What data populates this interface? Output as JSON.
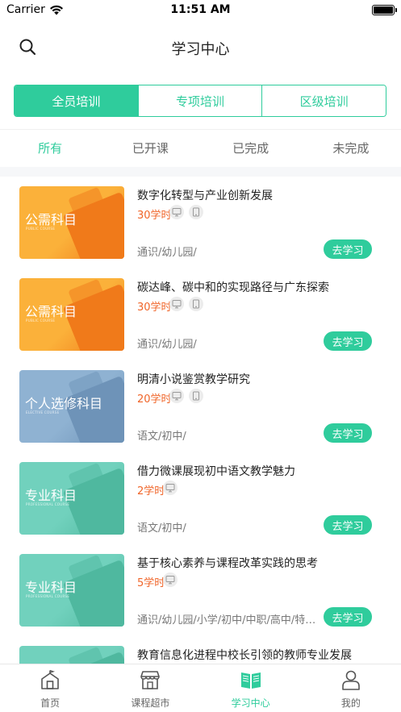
{
  "status": {
    "carrier": "Carrier",
    "time": "11:51 AM"
  },
  "nav": {
    "title": "学习中心"
  },
  "segments": [
    {
      "label": "全员培训",
      "active": true
    },
    {
      "label": "专项培训",
      "active": false
    },
    {
      "label": "区级培训",
      "active": false
    }
  ],
  "filters": [
    {
      "label": "所有",
      "active": true
    },
    {
      "label": "已开课",
      "active": false
    },
    {
      "label": "已完成",
      "active": false
    },
    {
      "label": "未完成",
      "active": false
    }
  ],
  "thumb_types": {
    "public": {
      "title": "公需科目",
      "subtitle": "PUBLIC COURSE",
      "bg": "#fbb13a",
      "fg": "#f07a1a"
    },
    "elective": {
      "title": "个人选修科目",
      "subtitle": "ELECTIVE COURSE",
      "bg": "#8fb2d2",
      "fg": "#6e93b8"
    },
    "professional": {
      "title": "专业科目",
      "subtitle": "PROFESSIONAL COURSE",
      "bg": "#71d1bd",
      "fg": "#4fb89f"
    }
  },
  "courses": [
    {
      "thumb": "public",
      "title": "数字化转型与产业创新发展",
      "hours": "30学时",
      "devices": [
        "monitor-icon",
        "tablet-icon"
      ],
      "tags": "通识/幼儿园/",
      "button": "去学习"
    },
    {
      "thumb": "public",
      "title": "碳达峰、碳中和的实现路径与广东探索",
      "hours": "30学时",
      "devices": [
        "monitor-icon",
        "tablet-icon"
      ],
      "tags": "通识/幼儿园/",
      "button": "去学习"
    },
    {
      "thumb": "elective",
      "title": "明清小说鉴赏教学研究",
      "hours": "20学时",
      "devices": [
        "monitor-icon",
        "tablet-icon"
      ],
      "tags": "语文/初中/",
      "button": "去学习"
    },
    {
      "thumb": "professional",
      "title": "借力微课展现初中语文教学魅力",
      "hours": "2学时",
      "devices": [
        "monitor-icon"
      ],
      "tags": "语文/初中/",
      "button": "去学习"
    },
    {
      "thumb": "professional",
      "title": "基于核心素养与课程改革实践的思考",
      "hours": "5学时",
      "devices": [
        "monitor-icon"
      ],
      "tags": "通识/幼儿园/小学/初中/中职/高中/特殊教育/",
      "button": "去学习"
    },
    {
      "thumb": "professional",
      "title": "教育信息化进程中校长引领的教师专业发展",
      "hours": "",
      "devices": [],
      "tags": "",
      "button": ""
    }
  ],
  "tabbar": [
    {
      "label": "首页",
      "icon": "home-icon",
      "active": false
    },
    {
      "label": "课程超市",
      "icon": "store-icon",
      "active": false
    },
    {
      "label": "学习中心",
      "icon": "book-icon",
      "active": true
    },
    {
      "label": "我的",
      "icon": "user-icon",
      "active": false
    }
  ],
  "colors": {
    "accent": "#2fcc9c",
    "hours": "#f06529"
  }
}
